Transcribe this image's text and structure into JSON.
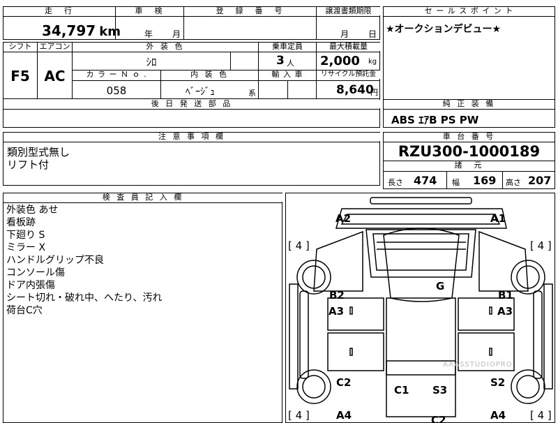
{
  "top": {
    "headers": {
      "mileage": "走　行",
      "inspection": "車　検",
      "registration": "登　録　番　号",
      "transfer_docs": "譲渡書類期限",
      "selling_points": "セ ー ル ス ポ イ ン ト"
    },
    "mileage_value": "34,797",
    "mileage_unit": "km",
    "year_label": "年",
    "month_label": "月",
    "transfer_month": "月",
    "transfer_day": "日",
    "selling_point_text": "★オークションデビュー★"
  },
  "row2": {
    "headers": {
      "shift": "シフト",
      "aircon": "エアコン",
      "exterior_color": "外 装 色",
      "capacity": "乗車定員",
      "max_load": "最大積載量",
      "color_no": "カ ラ ー Ｎ ｏ .",
      "interior_color": "内 装 色",
      "import": "輸 入 車",
      "recycle": "リサイクル預託金"
    },
    "shift": "F5",
    "aircon": "AC",
    "exterior_color": "ｼﾛ",
    "capacity": "3",
    "capacity_unit": "人",
    "max_load": "2,000",
    "max_load_unit": "kg",
    "color_no": "058",
    "interior_color": "ﾍﾞｰｼﾞｭ",
    "interior_suffix": "系",
    "recycle": "8,640",
    "recycle_unit": "円"
  },
  "later_parts": {
    "header": "後 日 発 送 部 品"
  },
  "equipment": {
    "header": "純 正 装 備",
    "text": "ABS ｴｱB PS PW"
  },
  "caution": {
    "header": "注 意 事 項 欄",
    "lines": [
      "類別型式無し",
      "リフト付"
    ]
  },
  "chassis": {
    "header": "車 台 番 号",
    "value": "RZU300-1000189"
  },
  "specs": {
    "header": "諸　元",
    "length_label": "長さ",
    "length": "474",
    "width_label": "幅",
    "width": "169",
    "height_label": "高さ",
    "height": "207"
  },
  "inspector": {
    "header": "検 査 員 記 入 欄",
    "lines": [
      "外装色 あせ",
      "看板跡",
      "下廻り S",
      "ミラー X",
      "ハンドルグリップ不良",
      "コンソール傷",
      "ドア内張傷",
      "シート切れ・破れ中、へたり、汚れ",
      "荷台C穴"
    ]
  },
  "diagram": {
    "labels": {
      "a2": "A2",
      "a1": "A1",
      "g": "G",
      "b2": "B2",
      "b1": "B1",
      "a3_left": "A3",
      "a3_right": "A3",
      "c2": "C2",
      "c1": "C1",
      "s3": "S3",
      "s2": "S2",
      "a4_left": "A4",
      "a4_right": "A4",
      "c2_bottom": "C2"
    },
    "tire_top_left": "[ 4 ]",
    "tire_top_right": "[ 4 ]",
    "tire_bottom_left": "[ 4 ]",
    "tire_bottom_right": "[ 4 ]",
    "watermark": "AAASSTUDIOPRO"
  }
}
